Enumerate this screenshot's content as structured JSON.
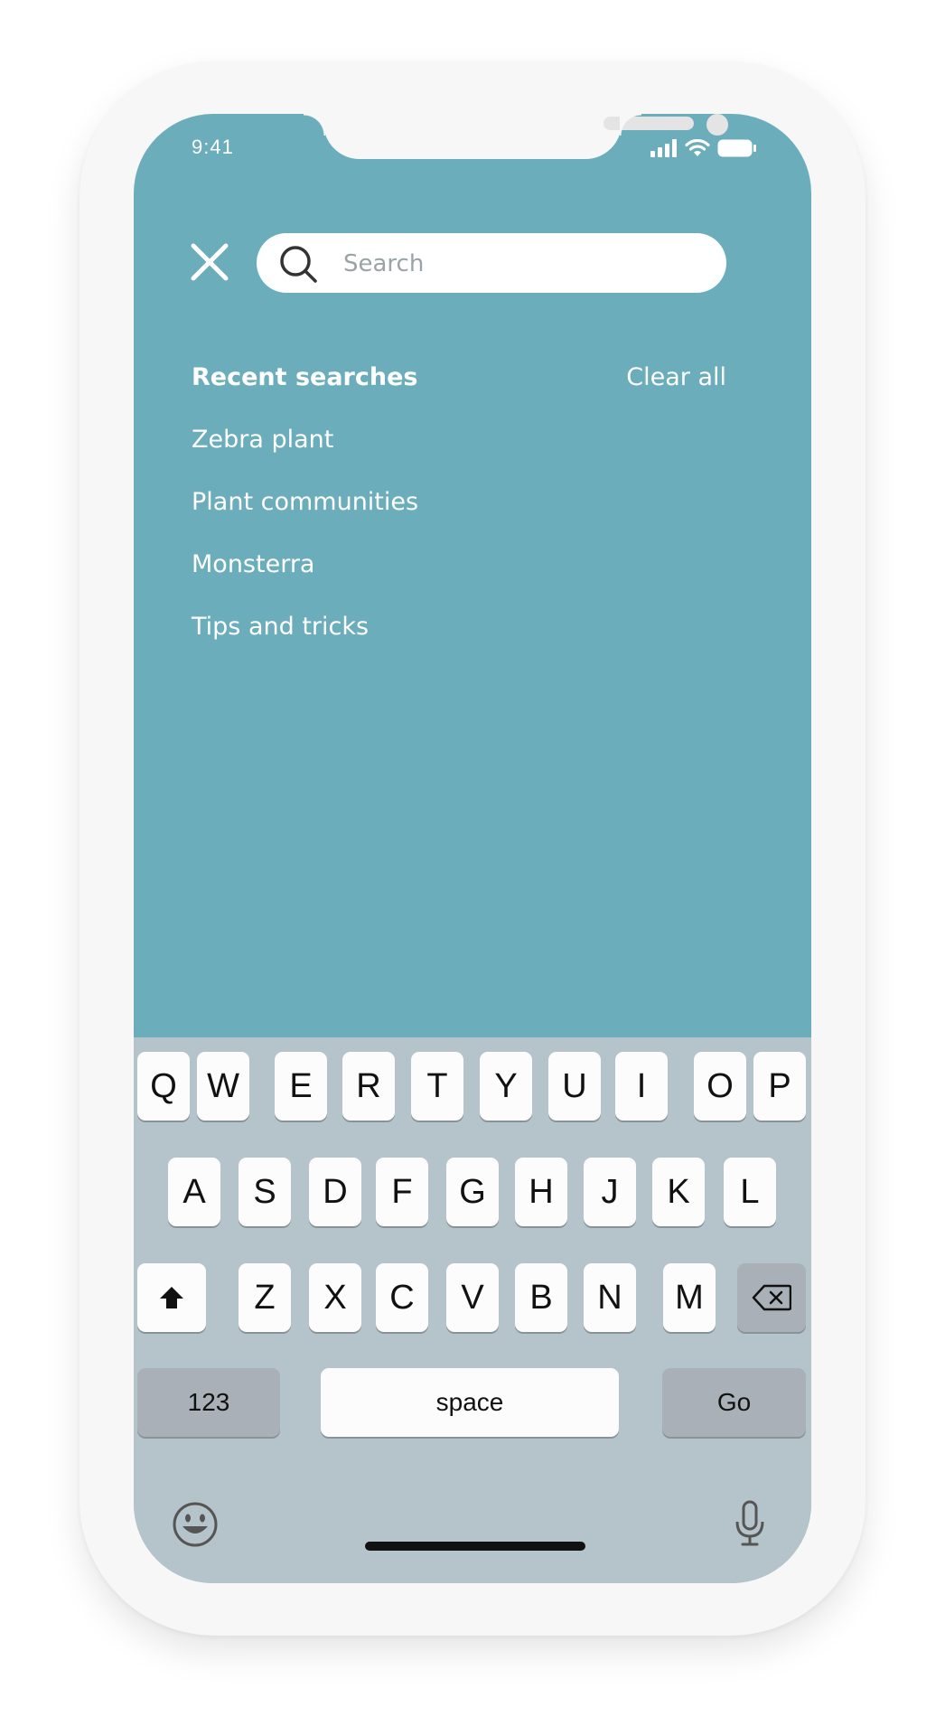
{
  "status_bar": {
    "time": "9:41",
    "icons": [
      "signal-icon",
      "wifi-icon",
      "battery-icon"
    ]
  },
  "search": {
    "placeholder": "Search",
    "close_icon": "close-icon",
    "search_icon": "search-icon"
  },
  "recent": {
    "title": "Recent searches",
    "clear_label": "Clear all",
    "items": [
      "Zebra plant",
      "Plant communities",
      "Monsterra",
      "Tips and tricks"
    ]
  },
  "keyboard": {
    "row1": [
      "Q",
      "W",
      "E",
      "R",
      "T",
      "Y",
      "U",
      "I",
      "O",
      "P"
    ],
    "row2": [
      "A",
      "S",
      "D",
      "F",
      "G",
      "H",
      "J",
      "K",
      "L"
    ],
    "row3": [
      "Z",
      "X",
      "C",
      "V",
      "B",
      "N",
      "M"
    ],
    "numbers_label": "123",
    "space_label": "space",
    "go_label": "Go",
    "icons": [
      "shift-icon",
      "backspace-icon",
      "emoji-icon",
      "microphone-icon"
    ]
  },
  "colors": {
    "screen_bg": "#6badbb",
    "keyboard_bg": "#b4c4ca",
    "key_bg": "#fcfcfd",
    "special_key_bg": "#a9b0b8"
  }
}
